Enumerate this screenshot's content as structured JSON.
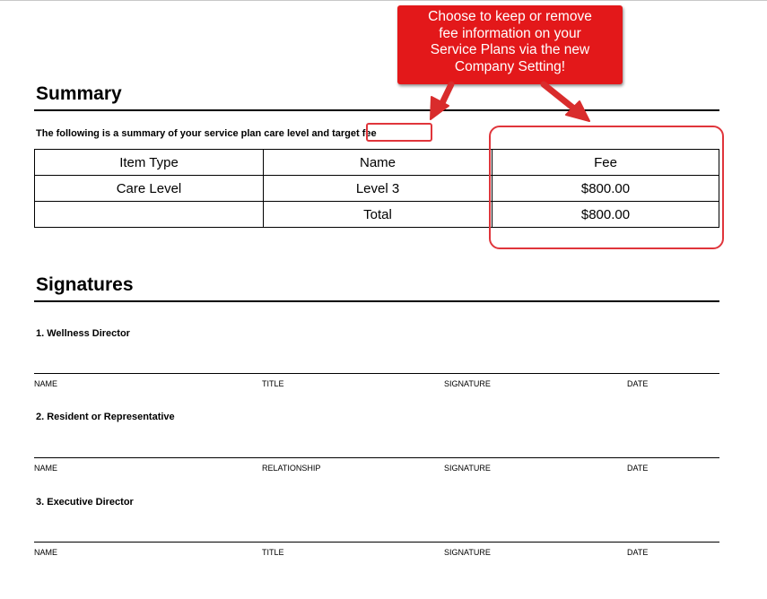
{
  "callout": {
    "lines": [
      "Choose to keep or remove",
      "fee information on your",
      "Service Plans via the new",
      "Company Setting!"
    ],
    "color": "#e3181a"
  },
  "summary": {
    "title": "Summary",
    "intro_prefix": "The following is a summary of your service plan care level and",
    "intro_highlight": "target fee",
    "table": {
      "headers": [
        "Item Type",
        "Name",
        "Fee"
      ],
      "rows": [
        [
          "Care Level",
          "Level 3",
          "$800.00"
        ],
        [
          "",
          "Total",
          "$800.00"
        ]
      ]
    }
  },
  "signatures": {
    "title": "Signatures",
    "sections": [
      {
        "title": "1. Wellness Director",
        "labels": [
          "NAME",
          "TITLE",
          "SIGNATURE",
          "DATE"
        ]
      },
      {
        "title": "2. Resident or Representative",
        "labels": [
          "NAME",
          "RELATIONSHIP",
          "SIGNATURE",
          "DATE"
        ]
      },
      {
        "title": "3. Executive Director",
        "labels": [
          "NAME",
          "TITLE",
          "SIGNATURE",
          "DATE"
        ]
      }
    ]
  },
  "highlight_color": "#e0353b"
}
